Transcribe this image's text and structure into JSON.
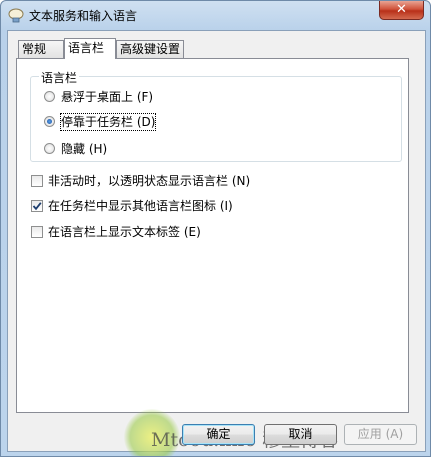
{
  "window": {
    "title": "文本服务和输入语言",
    "close_label": "✕"
  },
  "tabs": [
    {
      "label": "常规",
      "active": false
    },
    {
      "label": "语言栏",
      "active": true
    },
    {
      "label": "高级键设置",
      "active": false
    }
  ],
  "language_bar_group": {
    "title": "语言栏",
    "options": [
      {
        "label": "悬浮于桌面上 (F)",
        "checked": false
      },
      {
        "label": "停靠于任务栏 (D)",
        "checked": true
      },
      {
        "label": "隐藏 (H)",
        "checked": false
      }
    ]
  },
  "checkboxes": [
    {
      "label": "非活动时，以透明状态显示语言栏 (N)",
      "checked": false
    },
    {
      "label": "在任务栏中显示其他语言栏图标 (I)",
      "checked": true
    },
    {
      "label": "在语言栏上显示文本标签 (E)",
      "checked": false
    }
  ],
  "buttons": {
    "ok": "确定",
    "cancel": "取消",
    "apply": "应用 (A)"
  },
  "watermark": {
    "text": "Mtoou.info 穆童博客"
  },
  "colors": {
    "title_bar": "#bcd4ec",
    "close_button": "#c7432b",
    "default_button_border": "#3c7fb1"
  }
}
